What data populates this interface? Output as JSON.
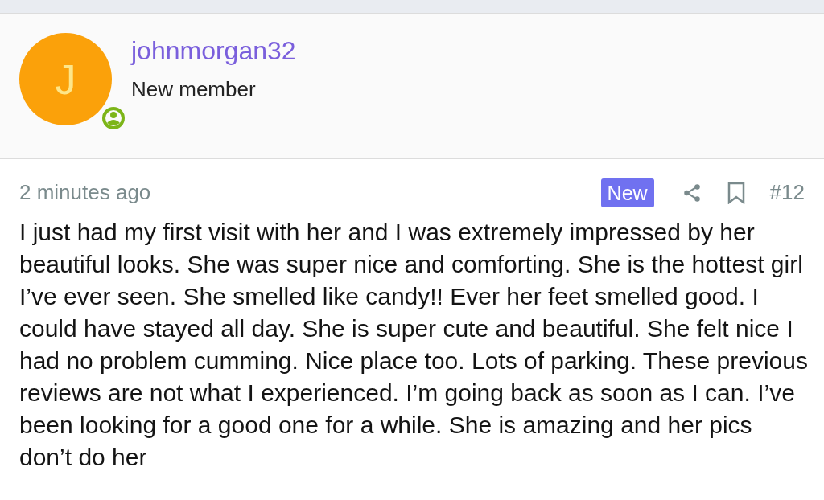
{
  "author": {
    "avatar_letter": "J",
    "online": true,
    "username": "johnmorgan32",
    "role": "New member"
  },
  "post": {
    "time": "2 minutes ago",
    "badge": "New",
    "number": "#12",
    "body": "I just had my first visit with her and I was extremely impressed by her beautiful looks. She was super nice and comforting. She is the hottest girl I’ve ever seen. She smelled like candy!! Ever her feet smelled good. I could have stayed all day. She is super cute and beautiful. She felt nice I had no problem cumming. Nice place too. Lots of parking. These previous reviews are not what I experienced. I’m going back as soon as I can. I’ve been looking for a good one for a while. She is amazing and her pics don’t do her"
  }
}
